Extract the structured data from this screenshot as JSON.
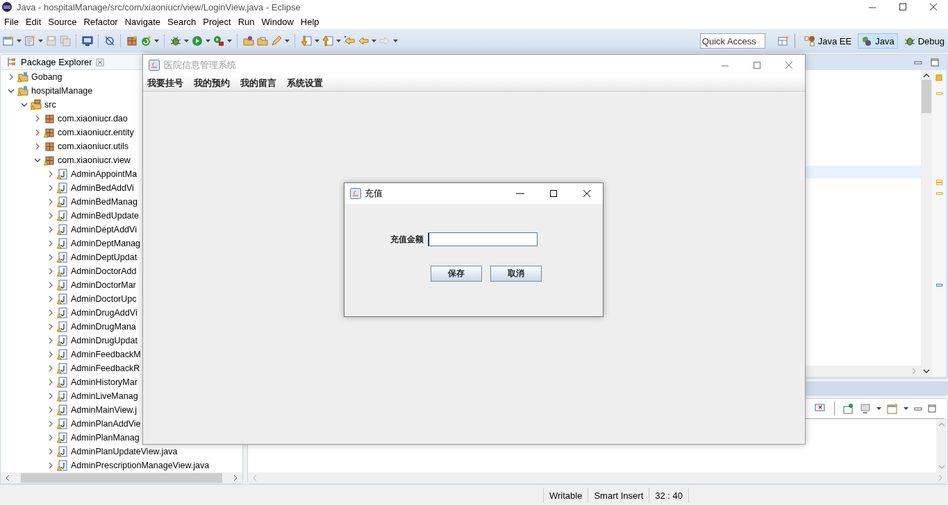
{
  "window": {
    "title": "Java - hospitalManage/src/com/xiaoniucr/view/LoginView.java - Eclipse"
  },
  "menu": [
    "File",
    "Edit",
    "Source",
    "Refactor",
    "Navigate",
    "Search",
    "Project",
    "Run",
    "Window",
    "Help"
  ],
  "quick_access": {
    "placeholder": "Quick Access"
  },
  "perspectives": [
    {
      "label": "Java EE",
      "selected": false
    },
    {
      "label": "Java",
      "selected": true
    },
    {
      "label": "Debug",
      "selected": false
    }
  ],
  "package_explorer": {
    "title": "Package Explorer",
    "tree": [
      {
        "label": "Gobang",
        "kind": "project",
        "warning": true,
        "expanded": false
      },
      {
        "label": "hospitalManage",
        "kind": "project",
        "warning": true,
        "expanded": true,
        "children": [
          {
            "label": "src",
            "kind": "folder",
            "warning": true,
            "expanded": true,
            "children": [
              {
                "label": "com.xiaoniucr.dao",
                "kind": "package",
                "warning": false,
                "expanded": false
              },
              {
                "label": "com.xiaoniucr.entity",
                "kind": "package",
                "warning": true,
                "expanded": false
              },
              {
                "label": "com.xiaoniucr.utils",
                "kind": "package",
                "warning": false,
                "expanded": false
              },
              {
                "label": "com.xiaoniucr.view",
                "kind": "package",
                "warning": true,
                "expanded": true,
                "children": [
                  {
                    "label": "AdminAppointMa",
                    "kind": "file",
                    "warning": true,
                    "expanded": false
                  },
                  {
                    "label": "AdminBedAddVi",
                    "kind": "file",
                    "warning": true,
                    "expanded": false
                  },
                  {
                    "label": "AdminBedManag",
                    "kind": "file",
                    "warning": true,
                    "expanded": false
                  },
                  {
                    "label": "AdminBedUpdate",
                    "kind": "file",
                    "warning": true,
                    "expanded": false
                  },
                  {
                    "label": "AdminDeptAddVi",
                    "kind": "file",
                    "warning": true,
                    "expanded": false
                  },
                  {
                    "label": "AdminDeptManag",
                    "kind": "file",
                    "warning": true,
                    "expanded": false
                  },
                  {
                    "label": "AdminDeptUpdat",
                    "kind": "file",
                    "warning": true,
                    "expanded": false
                  },
                  {
                    "label": "AdminDoctorAdd",
                    "kind": "file",
                    "warning": true,
                    "expanded": false
                  },
                  {
                    "label": "AdminDoctorMar",
                    "kind": "file",
                    "warning": true,
                    "expanded": false
                  },
                  {
                    "label": "AdminDoctorUpc",
                    "kind": "file",
                    "warning": true,
                    "expanded": false
                  },
                  {
                    "label": "AdminDrugAddVi",
                    "kind": "file",
                    "warning": true,
                    "expanded": false
                  },
                  {
                    "label": "AdminDrugMana",
                    "kind": "file",
                    "warning": true,
                    "expanded": false
                  },
                  {
                    "label": "AdminDrugUpdat",
                    "kind": "file",
                    "warning": true,
                    "expanded": false
                  },
                  {
                    "label": "AdminFeedbackM",
                    "kind": "file",
                    "warning": true,
                    "expanded": false
                  },
                  {
                    "label": "AdminFeedbackR",
                    "kind": "file",
                    "warning": true,
                    "expanded": false
                  },
                  {
                    "label": "AdminHistoryMar",
                    "kind": "file",
                    "warning": true,
                    "expanded": false
                  },
                  {
                    "label": "AdminLiveManag",
                    "kind": "file",
                    "warning": true,
                    "expanded": false
                  },
                  {
                    "label": "AdminMainView.j",
                    "kind": "file",
                    "warning": true,
                    "expanded": false
                  },
                  {
                    "label": "AdminPlanAddVie",
                    "kind": "file",
                    "warning": true,
                    "expanded": false
                  },
                  {
                    "label": "AdminPlanManag",
                    "kind": "file",
                    "warning": true,
                    "expanded": false
                  },
                  {
                    "label": "AdminPlanUpdateView.java",
                    "kind": "file",
                    "warning": true,
                    "expanded": false
                  },
                  {
                    "label": "AdminPrescriptionManageView.java",
                    "kind": "file",
                    "warning": true,
                    "expanded": false
                  }
                ]
              }
            ]
          }
        ]
      }
    ]
  },
  "app_window": {
    "title": "医院信息管理系统",
    "active": false,
    "menu": [
      "我要挂号",
      "我的预约",
      "我的留言",
      "系统设置"
    ]
  },
  "dialog": {
    "title": "充值",
    "amount_label": "充值金额",
    "amount_field": {
      "focused": true
    },
    "buttons": [
      "保存",
      "取消"
    ]
  },
  "status_bar": [
    "Writable",
    "Smart Insert",
    "32 : 40"
  ]
}
